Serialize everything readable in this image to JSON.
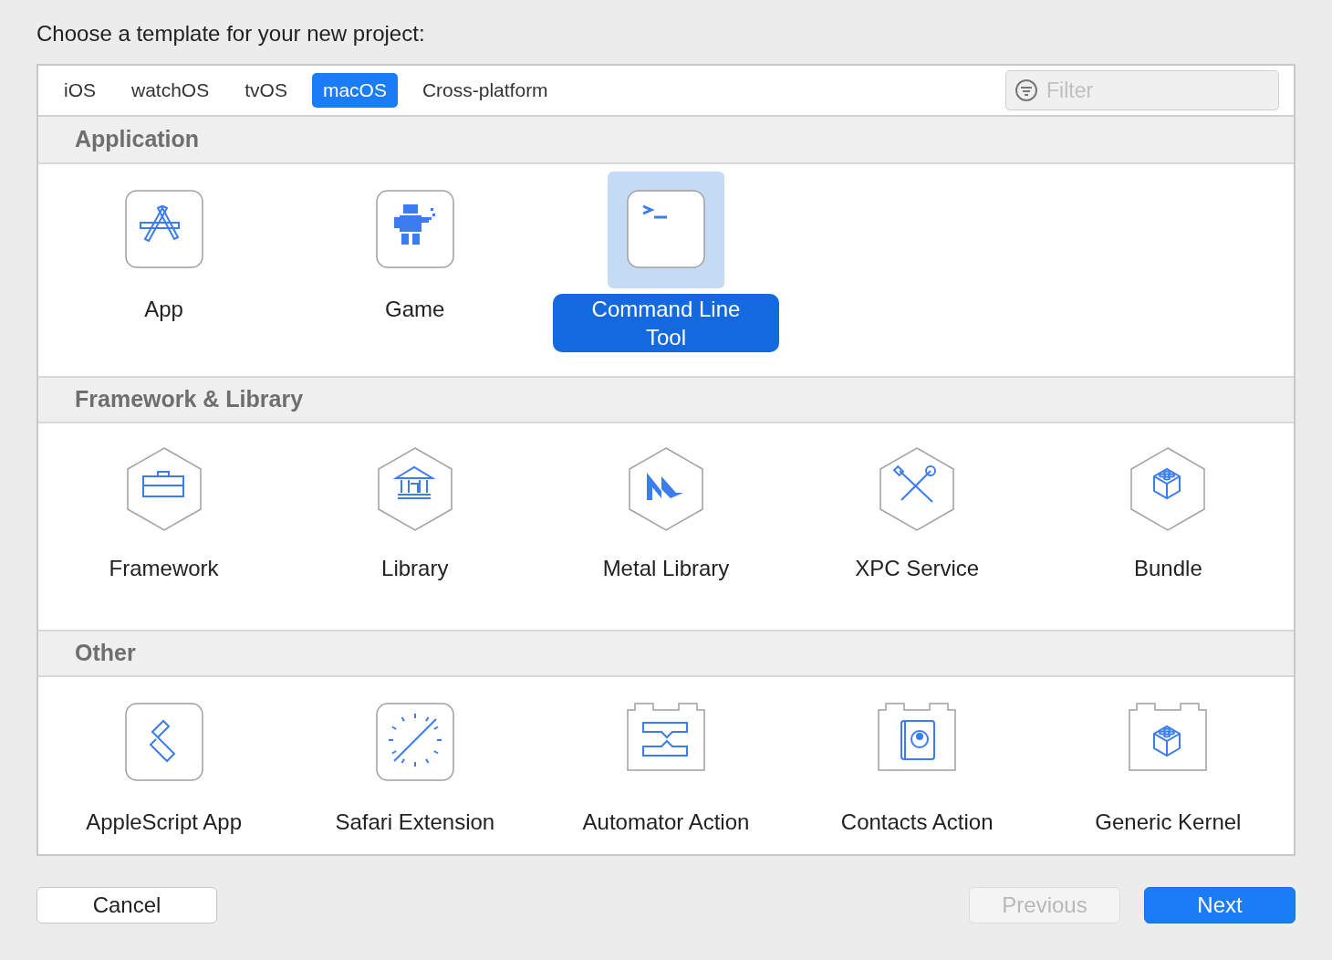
{
  "heading": "Choose a template for your new project:",
  "tabs": [
    {
      "label": "iOS",
      "selected": false
    },
    {
      "label": "watchOS",
      "selected": false
    },
    {
      "label": "tvOS",
      "selected": false
    },
    {
      "label": "macOS",
      "selected": true
    },
    {
      "label": "Cross-platform",
      "selected": false
    }
  ],
  "filter": {
    "placeholder": "Filter"
  },
  "sections": [
    {
      "title": "Application",
      "templates": [
        {
          "name": "App",
          "kind": "app",
          "selected": false
        },
        {
          "name": "Game",
          "kind": "game",
          "selected": false
        },
        {
          "name": "Command Line Tool",
          "kind": "terminal",
          "selected": true
        }
      ]
    },
    {
      "title": "Framework & Library",
      "templates": [
        {
          "name": "Framework",
          "kind": "framework",
          "selected": false
        },
        {
          "name": "Library",
          "kind": "library",
          "selected": false
        },
        {
          "name": "Metal Library",
          "kind": "metal",
          "selected": false
        },
        {
          "name": "XPC Service",
          "kind": "xpc",
          "selected": false
        },
        {
          "name": "Bundle",
          "kind": "bundle",
          "selected": false
        }
      ]
    },
    {
      "title": "Other",
      "templates": [
        {
          "name": "AppleScript App",
          "kind": "applescript",
          "selected": false
        },
        {
          "name": "Safari Extension",
          "kind": "safari",
          "selected": false
        },
        {
          "name": "Automator Action",
          "kind": "automator",
          "selected": false
        },
        {
          "name": "Contacts Action",
          "kind": "contacts",
          "selected": false
        },
        {
          "name": "Generic Kernel",
          "kind": "kernel",
          "selected": false
        }
      ]
    }
  ],
  "buttons": [
    {
      "label": "Cancel",
      "disabled": false,
      "default": false
    },
    {
      "label": "Previous",
      "disabled": true,
      "default": false
    },
    {
      "label": "Next",
      "disabled": false,
      "default": true
    }
  ]
}
